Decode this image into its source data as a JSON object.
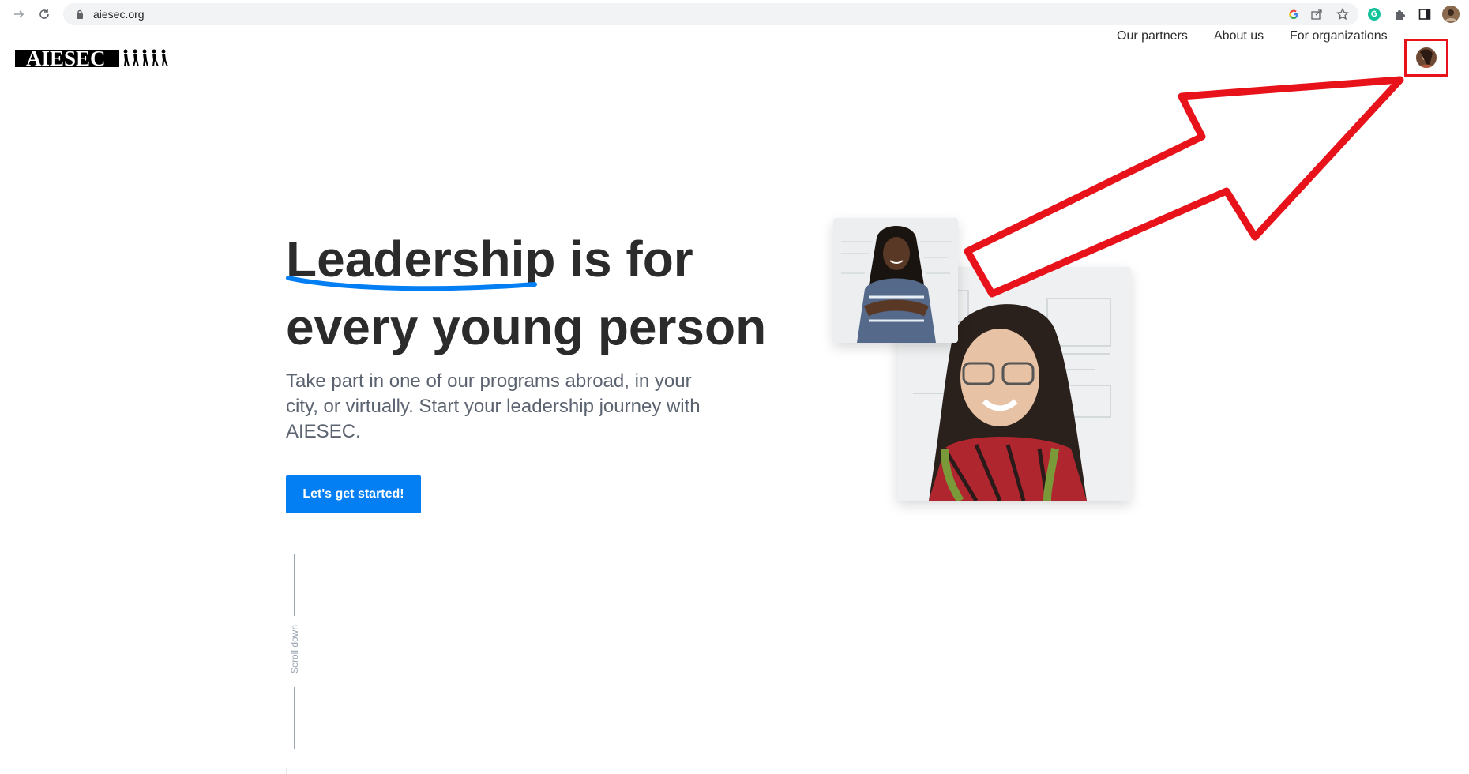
{
  "browser": {
    "url": "aiesec.org",
    "icons": [
      "forward-arrow-icon",
      "reload-icon",
      "lock-icon",
      "google-icon",
      "share-icon",
      "star-icon",
      "grammarly-icon",
      "puzzle-icon",
      "sidepanel-icon",
      "profile-icon"
    ]
  },
  "header": {
    "logo_text": "AIESEC",
    "nav": {
      "partners": "Our partners",
      "about": "About us",
      "organizations": "For organizations"
    }
  },
  "hero": {
    "title_highlight": "Leadership",
    "title_rest_line1": " is for",
    "title_line2": "every young person",
    "subtitle": "Take part in one of our programs abroad, in your city, or virtually. Start your leadership journey with AIESEC.",
    "cta_label": "Let's get started!"
  },
  "scroll": {
    "label": "Scroll down"
  },
  "colors": {
    "brand_blue": "#037ef3",
    "annotation_red": "#e8121b",
    "text_dark": "#2b2b2b",
    "text_muted": "#5b6370"
  }
}
